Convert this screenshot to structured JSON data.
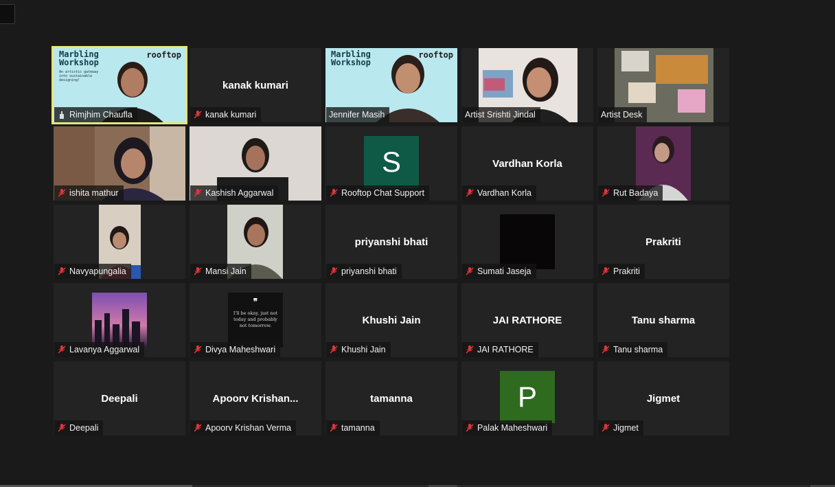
{
  "colors": {
    "background": "#1a1a1a",
    "tile": "#232323",
    "active_speaker_outline": "#e6e67a",
    "mic_muted": "#e0373a",
    "avatar_s": "#0f5a47",
    "avatar_p": "#2e6b1f"
  },
  "window": {
    "control_icon": "window-control"
  },
  "slide": {
    "title_line1": "Marbling",
    "title_line2": "Workshop",
    "logo": "rooftop",
    "subtitle": "An artistic gateway into sustainable designing!"
  },
  "participants": [
    {
      "name": "Rimjhim Chaufla",
      "label": "",
      "type": "video",
      "active": true,
      "muted": false
    },
    {
      "name": "kanak kumari",
      "label": "kanak kumari",
      "type": "name",
      "muted": true
    },
    {
      "name": "Jennifer Masih",
      "label": "",
      "type": "video",
      "muted": false
    },
    {
      "name": "Artist Srishti Jindal",
      "label": "",
      "type": "video",
      "muted": false
    },
    {
      "name": "Artist Desk",
      "label": "",
      "type": "video",
      "muted": false
    },
    {
      "name": "ishita mathur",
      "label": "",
      "type": "video",
      "muted": true
    },
    {
      "name": "Kashish Aggarwal",
      "label": "",
      "type": "video",
      "muted": true
    },
    {
      "name": "Rooftop Chat Support",
      "label": "S",
      "type": "avatar",
      "muted": true
    },
    {
      "name": "Vardhan Korla",
      "label": "Vardhan Korla",
      "type": "name",
      "muted": true
    },
    {
      "name": "Rut Badaya",
      "label": "",
      "type": "video",
      "muted": true
    },
    {
      "name": "Navyapungalia",
      "label": "",
      "type": "video",
      "muted": true
    },
    {
      "name": "Mansi Jain",
      "label": "",
      "type": "video",
      "muted": true
    },
    {
      "name": "priyanshi bhati",
      "label": "priyanshi bhati",
      "type": "name",
      "muted": true
    },
    {
      "name": "Sumati Jaseja",
      "label": "",
      "type": "video",
      "muted": true
    },
    {
      "name": "Prakriti",
      "label": "Prakriti",
      "type": "name",
      "muted": true
    },
    {
      "name": "Lavanya Aggarwal",
      "label": "",
      "type": "video",
      "muted": true
    },
    {
      "name": "Divya Maheshwari",
      "label": "",
      "type": "video",
      "muted": true
    },
    {
      "name": "Khushi Jain",
      "label": "Khushi Jain",
      "type": "name",
      "muted": true
    },
    {
      "name": "JAI RATHORE",
      "label": "JAI RATHORE",
      "type": "name",
      "muted": true
    },
    {
      "name": "Tanu sharma",
      "label": "Tanu sharma",
      "type": "name",
      "muted": true
    },
    {
      "name": "Deepali",
      "label": "Deepali",
      "type": "name",
      "muted": true
    },
    {
      "name": "Apoorv Krishan Verma",
      "label": "Apoorv  Krishan...",
      "type": "name",
      "muted": true
    },
    {
      "name": "tamanna",
      "label": "tamanna",
      "type": "name",
      "muted": true
    },
    {
      "name": "Palak Maheshwari",
      "label": "P",
      "type": "avatar",
      "muted": true
    },
    {
      "name": "Jigmet",
      "label": "Jigmet",
      "type": "name",
      "muted": true
    }
  ],
  "quote_text": "I'll be okay, just not today and probably not tomorrow."
}
